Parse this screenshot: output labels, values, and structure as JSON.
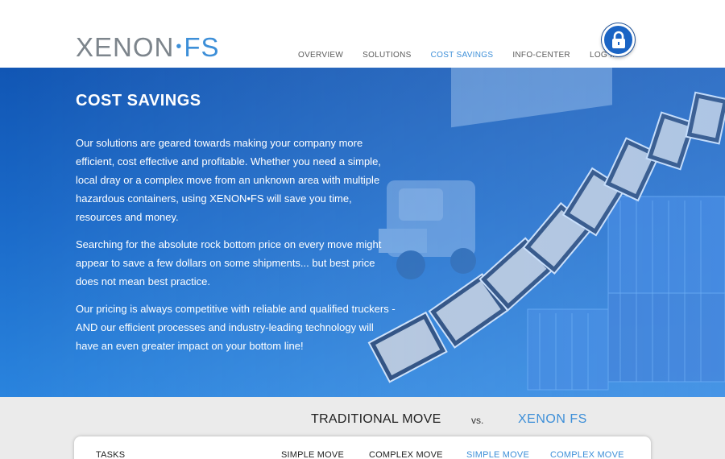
{
  "logo": {
    "xenon": "XENON",
    "dot": "•",
    "fs": "FS"
  },
  "nav": [
    {
      "label": "OVERVIEW",
      "active": false
    },
    {
      "label": "SOLUTIONS",
      "active": false
    },
    {
      "label": "COST SAVINGS",
      "active": true
    },
    {
      "label": "INFO-CENTER",
      "active": false
    },
    {
      "label": "LOG IN",
      "active": false
    }
  ],
  "icons": {
    "login": "lock-icon"
  },
  "hero": {
    "title": "COST SAVINGS",
    "paragraphs": [
      "Our solutions are geared towards making your company more efficient, cost effective and profitable. Whether you need a simple, local dray or a complex move from an unknown area with multiple hazardous containers, using XENON•FS will save you time, resources and money.",
      "Searching for the absolute rock bottom price on every move might appear to save a few dollars on some shipments... but best price does not mean best practice.",
      "Our pricing is always competitive with reliable and qualified truckers - AND our efficient processes and industry-leading technology will have an even greater impact on your bottom line!"
    ]
  },
  "comparison": {
    "traditional": "TRADITIONAL MOVE",
    "vs": "vs.",
    "xenon": "XENON FS",
    "headers": {
      "tasks": "TASKS",
      "trad_simple": "SIMPLE MOVE",
      "trad_complex": "COMPLEX MOVE",
      "xenon_simple": "SIMPLE MOVE",
      "xenon_complex": "COMPLEX MOVE"
    }
  },
  "colors": {
    "brand_blue": "#3d8fd8",
    "hero_blue": "#1a69c8",
    "logo_gray": "#7d858c"
  }
}
